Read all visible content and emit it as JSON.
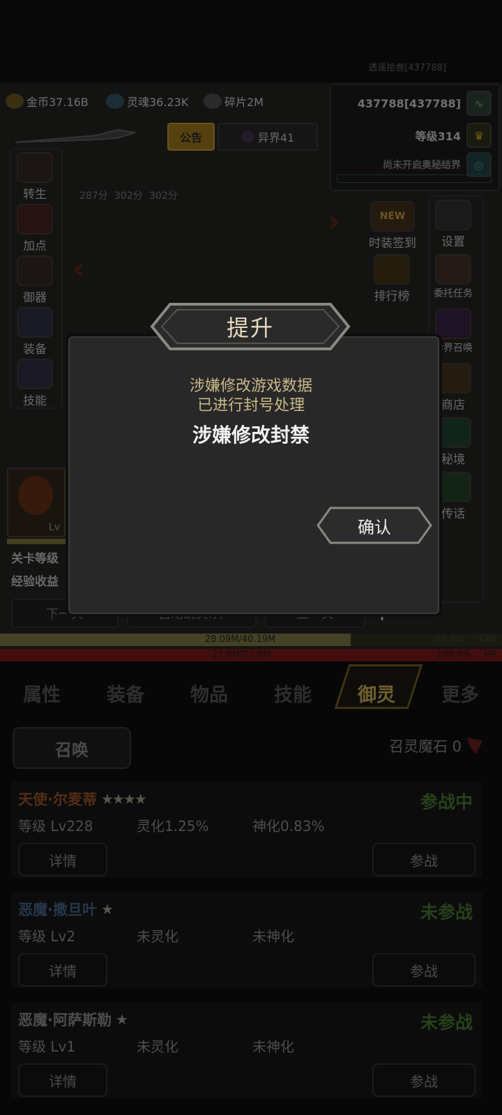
{
  "player_tag": "透遥拾叁[437788]",
  "resources": {
    "gold": "金币37.16B",
    "soul": "灵魂36.23K",
    "shard": "碎片2M"
  },
  "right_panel": {
    "id": "437788[437788]",
    "level": "等级314",
    "realm_status": "尚未开启奥秘结界"
  },
  "notice_label": "公告",
  "otherworld_label": "异界41",
  "scores": [
    "287分",
    "302分",
    "302分"
  ],
  "left_menu": [
    {
      "label": "转生",
      "icon": "rebirth-icon"
    },
    {
      "label": "加点",
      "icon": "add-points-icon"
    },
    {
      "label": "御器",
      "icon": "weapon-icon"
    },
    {
      "label": "装备",
      "icon": "equipment-icon"
    },
    {
      "label": "技能",
      "icon": "skill-icon"
    }
  ],
  "right_menu": [
    {
      "label": "时装签到",
      "icon": "fashion-checkin-icon",
      "badge": "NEW"
    },
    {
      "label": "设置",
      "icon": "gear-icon"
    },
    {
      "label": "排行榜",
      "icon": "trophy-icon"
    },
    {
      "label": "委托任务",
      "icon": "task-icon"
    },
    {
      "label": "异界召唤",
      "icon": "portal-icon"
    },
    {
      "label": "商店",
      "icon": "shop-icon"
    },
    {
      "label": "秘境",
      "icon": "secret-realm-icon"
    },
    {
      "label": "传话",
      "icon": "megaphone-icon"
    }
  ],
  "stage_info": {
    "lv_label": "Lv",
    "line1": "关卡等级",
    "line2": "经验收益"
  },
  "controls": {
    "next": "下一关",
    "auto": "自动跳关:开",
    "prev": "上一关",
    "plus": "+"
  },
  "exp_bar": {
    "text": "28.09M/40.19M",
    "percent": "69.9%",
    "label": "EXP",
    "fill": 0.699
  },
  "hp_bar": {
    "text": "21.8M/21.8M",
    "percent": "100.0%",
    "label": "HP",
    "fill": 1.0
  },
  "modal": {
    "title": "提升",
    "line1": "涉嫌修改游戏数据",
    "line2": "已进行封号处理",
    "headline": "涉嫌修改封禁",
    "confirm": "确认"
  },
  "tabs": [
    "属性",
    "装备",
    "物品",
    "技能",
    "御灵",
    "更多"
  ],
  "active_tab": "御灵",
  "summon": {
    "button": "召唤",
    "stone_label": "召灵魔石 0"
  },
  "spirits": [
    {
      "name": "天使·尔麦蒂",
      "stars": "★★★★",
      "name_color": "#8a4a22",
      "status": "参战中",
      "status_color": "#3f6a2a",
      "level": "等级 Lv228",
      "spirit": "灵化1.25%",
      "divine": "神化0.83%",
      "detail": "详情",
      "action": "参战"
    },
    {
      "name": "恶魔·撒旦叶",
      "stars": "★",
      "name_color": "#3e5a78",
      "status": "未参战",
      "status_color": "#3f6a2a",
      "level": "等级 Lv2",
      "spirit": "未灵化",
      "divine": "未神化",
      "detail": "详情",
      "action": "参战"
    },
    {
      "name": "恶魔·阿萨斯勒",
      "stars": "★",
      "name_color": "#7d7d7d",
      "status": "未参战",
      "status_color": "#3f6a2a",
      "level": "等级 Lv1",
      "spirit": "未灵化",
      "divine": "未神化",
      "detail": "详情",
      "action": "参战"
    }
  ]
}
